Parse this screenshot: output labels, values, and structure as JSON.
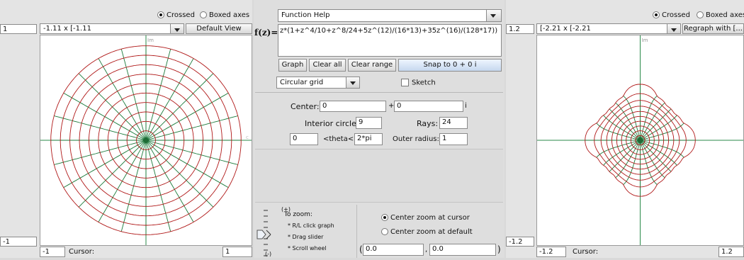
{
  "left": {
    "radio_crossed": "Crossed",
    "radio_boxed": "Boxed axes",
    "range_select": "-1.11 x [-1.11",
    "default_view": "Default View",
    "y_top": "1",
    "y_bottom": "-1",
    "x_left": "-1",
    "x_right": "1",
    "cursor_label": "Cursor:",
    "im_label": "Im",
    "re_label": "c"
  },
  "right": {
    "radio_crossed": "Crossed",
    "radio_boxed": "Boxed axes",
    "range_select": "[-2.21 x [-2.21",
    "regraph": "Regraph with [...",
    "y_top": "1.2",
    "y_bottom": "-1.2",
    "x_left": "-1.2",
    "x_right": "1.2",
    "cursor_label": "Cursor:",
    "im_label": "Im"
  },
  "middle": {
    "function_help": "Function Help",
    "fz_label": "f(z)=",
    "formula": "z*(1+z^4/10+z^8/24+5z^(12)/(16*13)+35z^(16)/(128*17))",
    "btn_graph": "Graph",
    "btn_clear_all": "Clear all",
    "btn_clear_range": "Clear range",
    "btn_snap": "Snap to 0 + 0 i",
    "grid_select": "Circular grid",
    "sketch": "Sketch",
    "center_label": "Center:",
    "center_re": "0",
    "plus": "+",
    "center_im": "0",
    "i_label": "i",
    "interior_label": "Interior circles:",
    "interior_value": "9",
    "rays_label": "Rays:",
    "rays_value": "24",
    "theta_min": "0",
    "theta_label": "<theta<",
    "theta_max": "2*pi",
    "outer_label": "Outer radius:",
    "outer_value": "1",
    "zoom_plus": "(+)",
    "zoom_minus": "(-)",
    "zoom_title": "To zoom:",
    "zoom_l1": "* R/L click graph",
    "zoom_l2": "* Drag slider",
    "zoom_l3": "* Scroll wheel",
    "center_cursor": "Center zoom at cursor",
    "center_default": "Center zoom at default",
    "paren_open": "(",
    "zoom_re": "0.0",
    "comma": ",",
    "zoom_im": "0.0",
    "paren_close": ")"
  },
  "colors": {
    "circle": "#b01818",
    "ray": "#1a7a3a",
    "axis": "#2a8a4a",
    "accent": "#6a8fc8"
  }
}
